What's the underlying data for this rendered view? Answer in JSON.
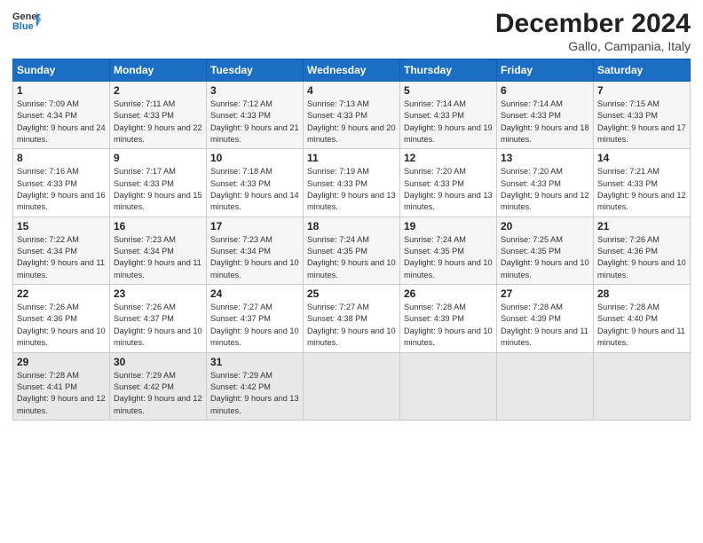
{
  "header": {
    "logo_general": "General",
    "logo_blue": "Blue",
    "month_year": "December 2024",
    "location": "Gallo, Campania, Italy"
  },
  "days_of_week": [
    "Sunday",
    "Monday",
    "Tuesday",
    "Wednesday",
    "Thursday",
    "Friday",
    "Saturday"
  ],
  "weeks": [
    [
      {
        "day": 1,
        "sunrise": "7:09 AM",
        "sunset": "4:34 PM",
        "daylight": "9 hours and 24 minutes."
      },
      {
        "day": 2,
        "sunrise": "7:11 AM",
        "sunset": "4:33 PM",
        "daylight": "9 hours and 22 minutes."
      },
      {
        "day": 3,
        "sunrise": "7:12 AM",
        "sunset": "4:33 PM",
        "daylight": "9 hours and 21 minutes."
      },
      {
        "day": 4,
        "sunrise": "7:13 AM",
        "sunset": "4:33 PM",
        "daylight": "9 hours and 20 minutes."
      },
      {
        "day": 5,
        "sunrise": "7:14 AM",
        "sunset": "4:33 PM",
        "daylight": "9 hours and 19 minutes."
      },
      {
        "day": 6,
        "sunrise": "7:14 AM",
        "sunset": "4:33 PM",
        "daylight": "9 hours and 18 minutes."
      },
      {
        "day": 7,
        "sunrise": "7:15 AM",
        "sunset": "4:33 PM",
        "daylight": "9 hours and 17 minutes."
      }
    ],
    [
      {
        "day": 8,
        "sunrise": "7:16 AM",
        "sunset": "4:33 PM",
        "daylight": "9 hours and 16 minutes."
      },
      {
        "day": 9,
        "sunrise": "7:17 AM",
        "sunset": "4:33 PM",
        "daylight": "9 hours and 15 minutes."
      },
      {
        "day": 10,
        "sunrise": "7:18 AM",
        "sunset": "4:33 PM",
        "daylight": "9 hours and 14 minutes."
      },
      {
        "day": 11,
        "sunrise": "7:19 AM",
        "sunset": "4:33 PM",
        "daylight": "9 hours and 13 minutes."
      },
      {
        "day": 12,
        "sunrise": "7:20 AM",
        "sunset": "4:33 PM",
        "daylight": "9 hours and 13 minutes."
      },
      {
        "day": 13,
        "sunrise": "7:20 AM",
        "sunset": "4:33 PM",
        "daylight": "9 hours and 12 minutes."
      },
      {
        "day": 14,
        "sunrise": "7:21 AM",
        "sunset": "4:33 PM",
        "daylight": "9 hours and 12 minutes."
      }
    ],
    [
      {
        "day": 15,
        "sunrise": "7:22 AM",
        "sunset": "4:34 PM",
        "daylight": "9 hours and 11 minutes."
      },
      {
        "day": 16,
        "sunrise": "7:23 AM",
        "sunset": "4:34 PM",
        "daylight": "9 hours and 11 minutes."
      },
      {
        "day": 17,
        "sunrise": "7:23 AM",
        "sunset": "4:34 PM",
        "daylight": "9 hours and 10 minutes."
      },
      {
        "day": 18,
        "sunrise": "7:24 AM",
        "sunset": "4:35 PM",
        "daylight": "9 hours and 10 minutes."
      },
      {
        "day": 19,
        "sunrise": "7:24 AM",
        "sunset": "4:35 PM",
        "daylight": "9 hours and 10 minutes."
      },
      {
        "day": 20,
        "sunrise": "7:25 AM",
        "sunset": "4:35 PM",
        "daylight": "9 hours and 10 minutes."
      },
      {
        "day": 21,
        "sunrise": "7:26 AM",
        "sunset": "4:36 PM",
        "daylight": "9 hours and 10 minutes."
      }
    ],
    [
      {
        "day": 22,
        "sunrise": "7:26 AM",
        "sunset": "4:36 PM",
        "daylight": "9 hours and 10 minutes."
      },
      {
        "day": 23,
        "sunrise": "7:26 AM",
        "sunset": "4:37 PM",
        "daylight": "9 hours and 10 minutes."
      },
      {
        "day": 24,
        "sunrise": "7:27 AM",
        "sunset": "4:37 PM",
        "daylight": "9 hours and 10 minutes."
      },
      {
        "day": 25,
        "sunrise": "7:27 AM",
        "sunset": "4:38 PM",
        "daylight": "9 hours and 10 minutes."
      },
      {
        "day": 26,
        "sunrise": "7:28 AM",
        "sunset": "4:39 PM",
        "daylight": "9 hours and 10 minutes."
      },
      {
        "day": 27,
        "sunrise": "7:28 AM",
        "sunset": "4:39 PM",
        "daylight": "9 hours and 11 minutes."
      },
      {
        "day": 28,
        "sunrise": "7:28 AM",
        "sunset": "4:40 PM",
        "daylight": "9 hours and 11 minutes."
      }
    ],
    [
      {
        "day": 29,
        "sunrise": "7:28 AM",
        "sunset": "4:41 PM",
        "daylight": "9 hours and 12 minutes."
      },
      {
        "day": 30,
        "sunrise": "7:29 AM",
        "sunset": "4:42 PM",
        "daylight": "9 hours and 12 minutes."
      },
      {
        "day": 31,
        "sunrise": "7:29 AM",
        "sunset": "4:42 PM",
        "daylight": "9 hours and 13 minutes."
      },
      null,
      null,
      null,
      null
    ]
  ]
}
